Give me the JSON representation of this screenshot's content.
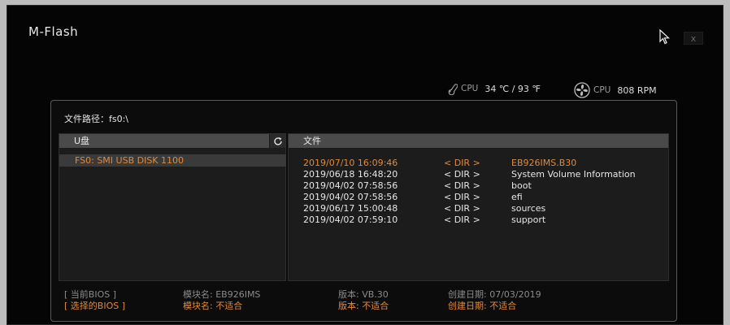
{
  "window": {
    "title": "M-Flash",
    "close_label": "x"
  },
  "status": {
    "cpu_temp_label": "CPU",
    "cpu_temp_value": "34 ℃ / 93 ℉",
    "cpu_fan_label": "CPU",
    "cpu_fan_value": "808 RPM"
  },
  "path": {
    "label": "文件路径：fs0:\\"
  },
  "drives": {
    "header": "U盘",
    "items": [
      {
        "label": "FS0: SMI USB DISK 1100"
      }
    ]
  },
  "files": {
    "header": "文件",
    "rows": [
      {
        "date": "2019/07/10 16:09:46",
        "type": "< DIR >",
        "name": "EB926IMS.B30",
        "selected": true
      },
      {
        "date": "2019/06/18 16:48:20",
        "type": "< DIR >",
        "name": "System Volume Information"
      },
      {
        "date": "2019/04/02 07:58:56",
        "type": "< DIR >",
        "name": "boot"
      },
      {
        "date": "2019/04/02 07:58:56",
        "type": "< DIR >",
        "name": "efi"
      },
      {
        "date": "2019/06/17 15:00:48",
        "type": "< DIR >",
        "name": "sources"
      },
      {
        "date": "2019/04/02 07:59:10",
        "type": "< DIR >",
        "name": "support"
      }
    ]
  },
  "bios_info": {
    "current": {
      "label": "[    当前BIOS    ]",
      "model": "模块名: EB926IMS",
      "version": "版本: VB.30",
      "date": "创建日期: 07/03/2019"
    },
    "selected": {
      "label": "[  选择的BIOS  ]",
      "model": "模块名: 不适合",
      "version": "版本: 不适合",
      "date": "创建日期: 不适合"
    }
  },
  "colors": {
    "accent": "#e08a3c",
    "panel_header": "#4a4a4a",
    "background": "#050505"
  }
}
